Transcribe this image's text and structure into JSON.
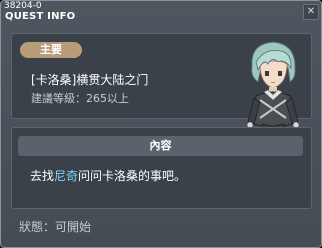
{
  "window": {
    "quest_id": "38204-0",
    "title": "QUEST INFO",
    "close_glyph": "✕"
  },
  "quest": {
    "category_badge": "主要",
    "name": "[卡洛桑]横贯大陆之门",
    "level_label": "建議等級：",
    "level_value": "265以上",
    "npc_portrait": "npc-silver-haired-boy"
  },
  "content": {
    "header": "內容",
    "desc_before": "去找",
    "desc_npc": "尼奇",
    "desc_after": "问问卡洛桑的事吧。"
  },
  "status": {
    "label": "狀態：",
    "value": "可開始"
  },
  "colors": {
    "badge": "#b89b78",
    "npc_highlight": "#7ed8ff",
    "panel": "#3a4148"
  }
}
